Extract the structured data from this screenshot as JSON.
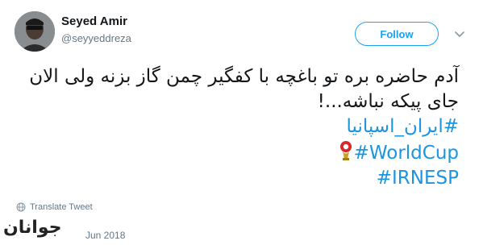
{
  "user": {
    "display_name": "Seyed Amir",
    "handle": "@seyyeddreza"
  },
  "follow_button_label": "Follow",
  "tweet": {
    "line1": "آدم حاضره بره تو باغچه با کفگیر چمن گاز بزنه ولی الان",
    "line2": "جای پیکه نباشه...!",
    "hashtags": [
      "#ایران_اسپانیا",
      "#WorldCup",
      "#IRNESP"
    ]
  },
  "translate_label": "Translate Tweet",
  "date": "Jun 2018",
  "watermark": "جوانان",
  "colors": {
    "link": "#1b95e0",
    "follow_border": "#1da1f2",
    "muted": "#657786"
  },
  "icons": {
    "caret": "chevron-down-icon",
    "globe": "globe-icon",
    "trophy": "worldcup-ball-icon"
  }
}
